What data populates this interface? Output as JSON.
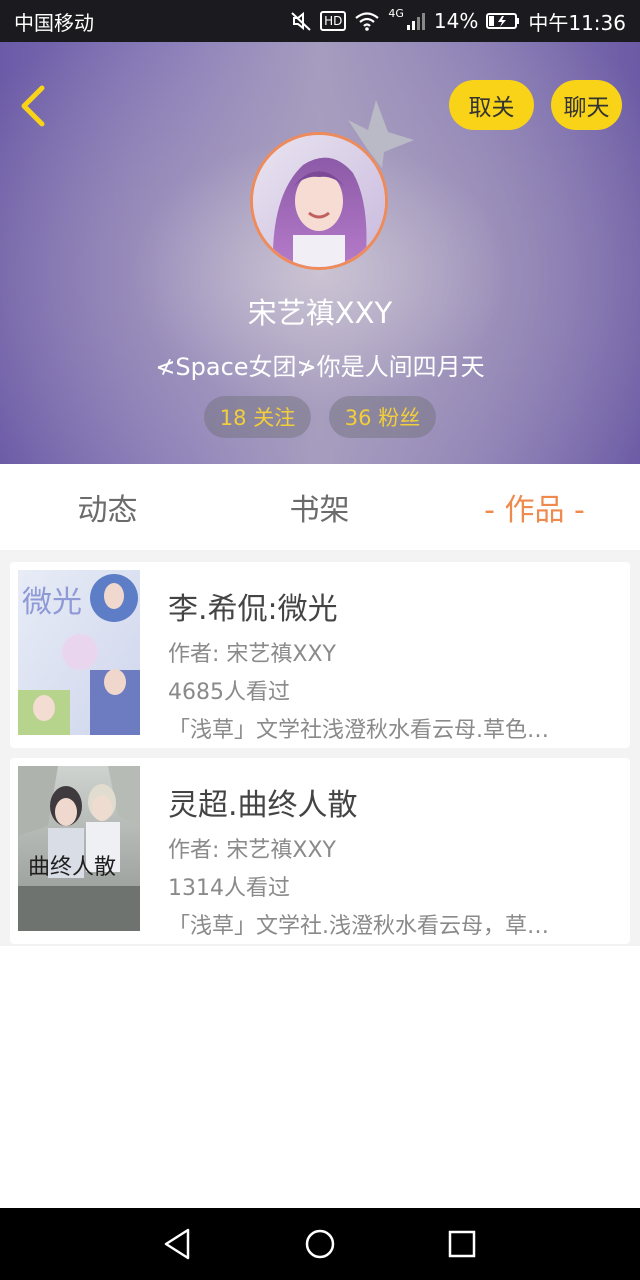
{
  "status_bar": {
    "carrier": "中国移动",
    "hd": "HD",
    "network": "4G",
    "battery": "14%",
    "time": "中午11:36"
  },
  "profile": {
    "unfollow_label": "取关",
    "chat_label": "聊天",
    "username": "宋艺禛XXY",
    "signature": "≮Space女团≯你是人间四月天",
    "following": "18 关注",
    "fans": "36 粉丝"
  },
  "tabs": [
    {
      "label": "动态",
      "active": false
    },
    {
      "label": "书架",
      "active": false
    },
    {
      "label": "- 作品 -",
      "active": true
    }
  ],
  "books": [
    {
      "title": "李.希侃:微光",
      "author": "作者: 宋艺禛XXY",
      "views": "4685人看过",
      "desc": "「浅草」文学社浅澄秋水看云母.草色…",
      "cover_text": "微光"
    },
    {
      "title": "灵超.曲终人散",
      "author": "作者: 宋艺禛XXY",
      "views": "1314人看过",
      "desc": "「浅草」文学社.浅澄秋水看云母，草…",
      "cover_text": "曲终人散"
    }
  ],
  "colors": {
    "accent": "#ee8a4d",
    "button": "#f8d318",
    "stat_text": "#f2cf3a"
  },
  "icons": {
    "back": "chevron-left-icon",
    "crown": "crown-icon",
    "mute": "mute-icon",
    "wifi": "wifi-icon",
    "signal": "signal-icon",
    "battery": "battery-icon",
    "nav_back": "triangle-back-icon",
    "nav_home": "circle-home-icon",
    "nav_recent": "square-recent-icon"
  }
}
